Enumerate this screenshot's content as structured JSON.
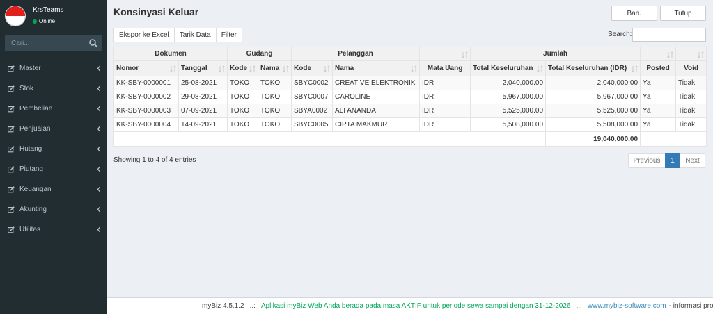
{
  "sidebar": {
    "user_name": "KrsTeams",
    "user_status": "Online",
    "search_placeholder": "Cari...",
    "menu": [
      {
        "label": "Master"
      },
      {
        "label": "Stok"
      },
      {
        "label": "Pembelian"
      },
      {
        "label": "Penjualan"
      },
      {
        "label": "Hutang"
      },
      {
        "label": "Piutang"
      },
      {
        "label": "Keuangan"
      },
      {
        "label": "Akunting"
      },
      {
        "label": "Utilitas"
      }
    ]
  },
  "page": {
    "title": "Konsinyasi Keluar",
    "btn_new": "Baru",
    "btn_close": "Tutup",
    "tools": [
      "Ekspor ke Excel",
      "Tarik Data",
      "Filter"
    ],
    "search_label": "Search:",
    "search_value": ""
  },
  "table": {
    "groups": {
      "dokumen": "Dokumen",
      "gudang": "Gudang",
      "pelanggan": "Pelanggan",
      "jumlah": "Jumlah"
    },
    "columns": {
      "nomor": "Nomor",
      "tanggal": "Tanggal",
      "g_kode": "Kode",
      "g_nama": "Nama",
      "p_kode": "Kode",
      "p_nama": "Nama",
      "mata_uang": "Mata Uang",
      "total": "Total Keseluruhan",
      "total_idr": "Total Keseluruhan (IDR)",
      "posted": "Posted",
      "void": "Void"
    },
    "rows": [
      {
        "nomor": "KK-SBY-0000001",
        "tanggal": "25-08-2021",
        "g_kode": "TOKO",
        "g_nama": "TOKO",
        "p_kode": "SBYC0002",
        "p_nama": "CREATIVE ELEKTRONIK",
        "mata_uang": "IDR",
        "total": "2,040,000.00",
        "total_idr": "2,040,000.00",
        "posted": "Ya",
        "void": "Tidak"
      },
      {
        "nomor": "KK-SBY-0000002",
        "tanggal": "29-08-2021",
        "g_kode": "TOKO",
        "g_nama": "TOKO",
        "p_kode": "SBYC0007",
        "p_nama": "CAROLINE",
        "mata_uang": "IDR",
        "total": "5,967,000.00",
        "total_idr": "5,967,000.00",
        "posted": "Ya",
        "void": "Tidak"
      },
      {
        "nomor": "KK-SBY-0000003",
        "tanggal": "07-09-2021",
        "g_kode": "TOKO",
        "g_nama": "TOKO",
        "p_kode": "SBYA0002",
        "p_nama": "ALI ANANDA",
        "mata_uang": "IDR",
        "total": "5,525,000.00",
        "total_idr": "5,525,000.00",
        "posted": "Ya",
        "void": "Tidak"
      },
      {
        "nomor": "KK-SBY-0000004",
        "tanggal": "14-09-2021",
        "g_kode": "TOKO",
        "g_nama": "TOKO",
        "p_kode": "SBYC0005",
        "p_nama": "CIPTA MAKMUR",
        "mata_uang": "IDR",
        "total": "5,508,000.00",
        "total_idr": "5,508,000.00",
        "posted": "Ya",
        "void": "Tidak"
      }
    ],
    "footer_total": "19,040,000.00"
  },
  "pagination": {
    "info": "Showing 1 to 4 of 4 entries",
    "previous": "Previous",
    "current": "1",
    "next": "Next"
  },
  "footer": {
    "version": "myBiz 4.5.1.2",
    "separator": "..:",
    "aktif_text": "Aplikasi myBiz Web Anda berada pada masa AKTIF untuk periode sewa sampai dengan 31-12-2026",
    "site": "www.mybiz-software.com",
    "info": "- informasi prod"
  },
  "colors": {
    "sidebar_bg": "#222d32",
    "accent": "#337ab7",
    "online": "#00a65a",
    "footer_aktif": "#00a65a",
    "footer_link": "#3c8dbc"
  },
  "icons": {
    "menu_item": "edit-icon",
    "submenu": "chevron-left-icon",
    "search": "search-icon",
    "sort": "sort-icon"
  }
}
